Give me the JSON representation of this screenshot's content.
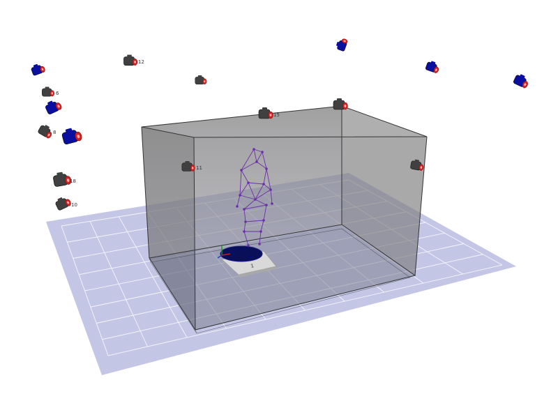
{
  "viewport": {
    "background": "#ffffff",
    "floor_color": "#c4c6e6",
    "grid_line_color": "#ffffff",
    "volume_fill": "#7a7a7a",
    "volume_edge_color": "#333333",
    "skeleton_color": "#6b2fa8",
    "active_camera_color": "#0b0fa0",
    "inactive_camera_color": "#404040",
    "lens_color": "#d42020"
  },
  "cameras": [
    {
      "id": "cam-a",
      "label": "",
      "active": true
    },
    {
      "id": "cam-12",
      "label": "12",
      "active": false
    },
    {
      "id": "cam-b",
      "label": "",
      "active": false
    },
    {
      "id": "cam-c",
      "label": "",
      "active": true
    },
    {
      "id": "cam-d",
      "label": "",
      "active": true
    },
    {
      "id": "cam-e",
      "label": "",
      "active": true
    },
    {
      "id": "cam-6",
      "label": "6",
      "active": false
    },
    {
      "id": "cam-f",
      "label": "",
      "active": true
    },
    {
      "id": "cam-8",
      "label": "8",
      "active": false
    },
    {
      "id": "cam-g",
      "label": "",
      "active": true
    },
    {
      "id": "cam-18",
      "label": "18",
      "active": false
    },
    {
      "id": "cam-10",
      "label": "10",
      "active": false
    },
    {
      "id": "cam-15",
      "label": "15",
      "active": false
    },
    {
      "id": "cam-h",
      "label": "",
      "active": false
    },
    {
      "id": "cam-11",
      "label": "11",
      "active": false
    },
    {
      "id": "cam-i",
      "label": "",
      "active": false
    }
  ],
  "marker_plate": {
    "label": "1"
  }
}
